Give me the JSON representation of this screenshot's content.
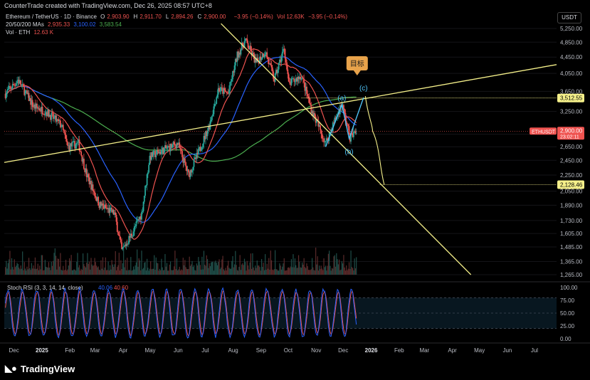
{
  "header": {
    "created_by": "CounterTrade created with TradingView.com, Dec 26, 2025 08:57 UTC+8",
    "currency_button": "USDT"
  },
  "legend": {
    "symbol": "Ethereum / TetherUS · 1D · Binance",
    "ohlc": [
      {
        "k": "O",
        "v": "2,903.90"
      },
      {
        "k": "H",
        "v": "2,911.70"
      },
      {
        "k": "L",
        "v": "2,894.26"
      },
      {
        "k": "C",
        "v": "2,900.00"
      }
    ],
    "change": "−3.95 (−0.14%)",
    "vol_inline": "Vol 12.63K",
    "vol_change": "−3.95 (−0.14%)",
    "ma_label": "20/50/200 MAs",
    "ma_values": [
      "2,935.33",
      "3,100.02",
      "3,583.54"
    ],
    "vol_label": "Vol · ETH",
    "vol_value": "12.63 K"
  },
  "colors": {
    "up": "#26a69a",
    "down": "#ef5350",
    "ma20": "#ef5350",
    "ma50": "#2962ff",
    "ma200": "#4caf50",
    "trend": "#f5f08a",
    "wave": "#4fc3f7",
    "target_box": "#e8a34b",
    "rsi_k": "#2962ff",
    "rsi_d": "#ef5350"
  },
  "annotations": {
    "target": "目标",
    "wave_a": "(a)",
    "wave_b": "(b)",
    "wave_c": "(c)",
    "price_tag_symbol": "ETHUSDT",
    "price_tag_value": "2,900.00",
    "price_tag_timer": "23:02:11",
    "level_high": "3,512.55",
    "level_low": "2,128.46"
  },
  "rsi": {
    "label": "Stoch RSI (3, 3, 14, 14, close)",
    "k_value": "40.06",
    "d_value": "40.60"
  },
  "footer": {
    "brand": "TradingView"
  },
  "chart_data": {
    "type": "candlestick",
    "symbol": "ETHUSDT",
    "y_axis": {
      "scale": "log",
      "ticks": [
        5250,
        4850,
        4450,
        4050,
        3650,
        3250,
        2850,
        2650,
        2450,
        2250,
        2050,
        1890,
        1730,
        1605,
        1485,
        1365,
        1265
      ],
      "tick_labels": [
        "5,250.00",
        "4,850.00",
        "4,450.00",
        "4,050.00",
        "3,650.00",
        "3,250.00",
        "2,850.00",
        "2,650.00",
        "2,450.00",
        "2,250.00",
        "2,050.00",
        "1,890.00",
        "1,730.00",
        "1,605.00",
        "1,485.00",
        "1,365.00",
        "1,265.00"
      ]
    },
    "x_axis": {
      "tick_labels": [
        "Dec",
        "2025",
        "Feb",
        "Mar",
        "Apr",
        "May",
        "Jun",
        "Jul",
        "Aug",
        "Sep",
        "Oct",
        "Nov",
        "Dec",
        "2026",
        "Feb",
        "Mar",
        "Apr",
        "May",
        "Jun",
        "Jul"
      ]
    },
    "price_path": [
      [
        "2024-12-01",
        3600
      ],
      [
        "2024-12-15",
        3900
      ],
      [
        "2025-01-01",
        3350
      ],
      [
        "2025-01-15",
        3250
      ],
      [
        "2025-02-01",
        3000
      ],
      [
        "2025-02-08",
        2650
      ],
      [
        "2025-02-20",
        2700
      ],
      [
        "2025-03-01",
        2250
      ],
      [
        "2025-03-15",
        1900
      ],
      [
        "2025-04-01",
        1800
      ],
      [
        "2025-04-09",
        1450
      ],
      [
        "2025-04-20",
        1600
      ],
      [
        "2025-05-01",
        1800
      ],
      [
        "2025-05-10",
        2500
      ],
      [
        "2025-05-25",
        2600
      ],
      [
        "2025-06-10",
        2700
      ],
      [
        "2025-06-22",
        2250
      ],
      [
        "2025-07-01",
        2500
      ],
      [
        "2025-07-15",
        3000
      ],
      [
        "2025-07-25",
        3700
      ],
      [
        "2025-08-05",
        3600
      ],
      [
        "2025-08-15",
        4500
      ],
      [
        "2025-08-24",
        4900
      ],
      [
        "2025-09-05",
        4300
      ],
      [
        "2025-09-15",
        4600
      ],
      [
        "2025-09-25",
        3900
      ],
      [
        "2025-10-06",
        4700
      ],
      [
        "2025-10-11",
        3800
      ],
      [
        "2025-10-25",
        4000
      ],
      [
        "2025-11-05",
        3300
      ],
      [
        "2025-11-21",
        2700
      ],
      [
        "2025-11-30",
        3050
      ],
      [
        "2025-12-09",
        3400
      ],
      [
        "2025-12-18",
        2800
      ],
      [
        "2025-12-25",
        2900
      ]
    ],
    "moving_averages": [
      {
        "name": "MA20",
        "last": 2935.33
      },
      {
        "name": "MA50",
        "last": 3100.02
      },
      {
        "name": "MA200",
        "last": 3583.54
      }
    ],
    "horizontal_levels": [
      3512.55,
      2128.46
    ],
    "projection": [
      [
        "2025-12-25",
        2900
      ],
      [
        "2026-01-04",
        3550
      ],
      [
        "2026-01-12",
        2900
      ],
      [
        "2026-01-25",
        2128
      ]
    ],
    "stoch_rsi": {
      "k": 40.06,
      "d": 40.6,
      "ticks": [
        100,
        75,
        50,
        25,
        0
      ],
      "tick_labels": [
        "100.00",
        "75.00",
        "50.00",
        "25.00",
        "0.00"
      ]
    }
  }
}
